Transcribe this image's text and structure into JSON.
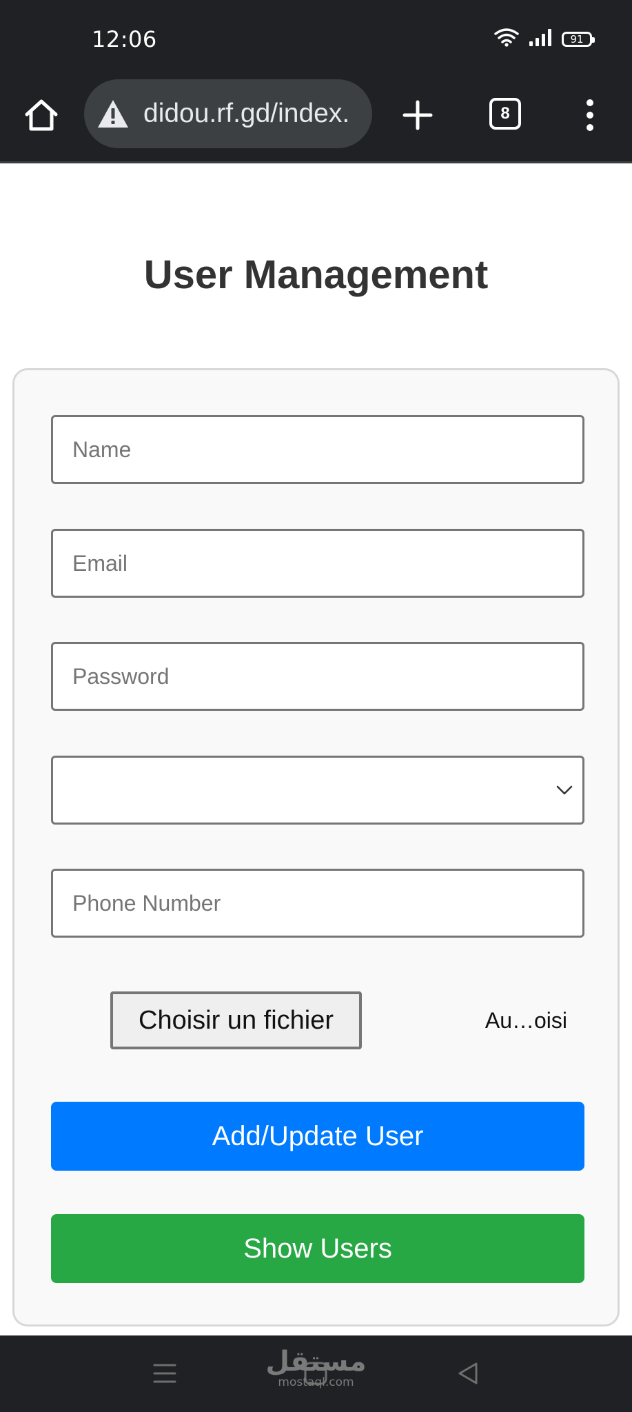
{
  "status_bar": {
    "time": "12:06",
    "battery": "91",
    "icons": [
      "wifi-icon",
      "signal-icon",
      "battery-icon"
    ]
  },
  "browser": {
    "url": "didou.rf.gd/index.",
    "tab_count": "8",
    "icons": [
      "home-icon",
      "warning-icon",
      "plus-icon",
      "tabs-icon",
      "more-vert-icon"
    ]
  },
  "page": {
    "title": "User Management"
  },
  "form": {
    "name_placeholder": "Name",
    "email_placeholder": "Email",
    "password_placeholder": "Password",
    "role_value": "",
    "phone_placeholder": "Phone Number",
    "file_button_label": "Choisir un fichier",
    "file_status": "Au…oisi",
    "submit_label": "Add/Update User",
    "show_users_label": "Show Users"
  },
  "colors": {
    "primary": "#007bff",
    "success": "#28a745",
    "title": "#333333",
    "browser_chrome": "#202124"
  },
  "nav_bar": {
    "icons": [
      "menu-icon",
      "home-square-icon",
      "back-icon"
    ]
  },
  "watermark": {
    "main": "مستقل",
    "sub": "mostaql.com"
  }
}
